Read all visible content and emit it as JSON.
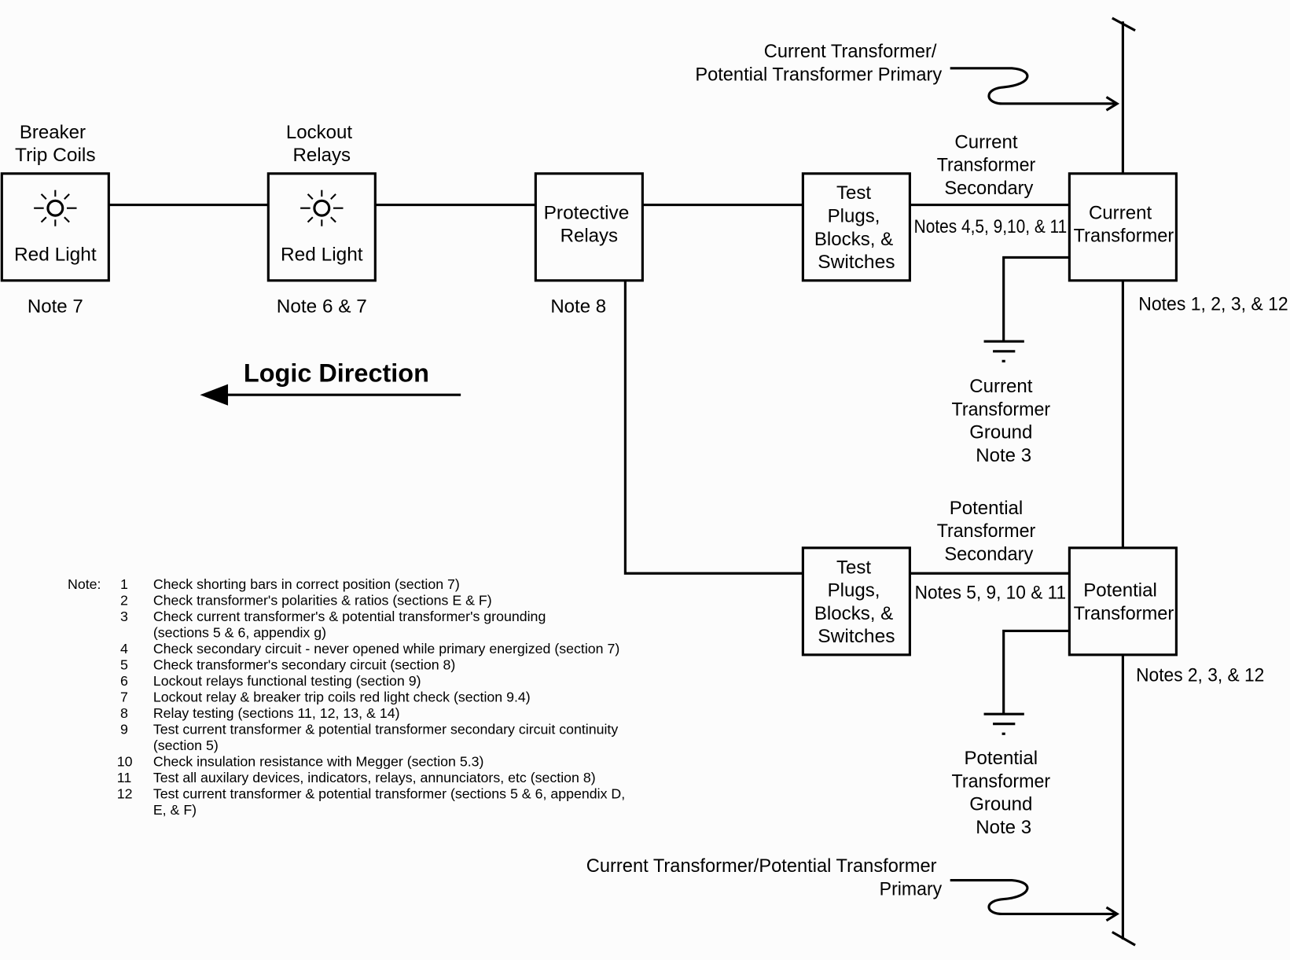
{
  "colors": {
    "line": "#000000",
    "background": "#fcfcfc"
  },
  "primary_top": [
    "Current Transformer/",
    "Potential Transformer Primary"
  ],
  "primary_bottom": [
    "Current Transformer/Potential Transformer",
    "Primary"
  ],
  "breaker": {
    "title": [
      "Breaker",
      "Trip Coils"
    ],
    "label": "Red Light",
    "note": "Note 7",
    "icon": "light-icon"
  },
  "lockout": {
    "title": [
      "Lockout",
      "Relays"
    ],
    "label": "Red Light",
    "note": "Note 6 & 7",
    "icon": "light-icon"
  },
  "protective": {
    "label": [
      "Protective",
      "Relays"
    ],
    "note": "Note 8"
  },
  "test_ct": {
    "label": [
      "Test",
      "Plugs,",
      "Blocks, &",
      "Switches"
    ]
  },
  "test_pt": {
    "label": [
      "Test",
      "Plugs,",
      "Blocks, &",
      "Switches"
    ]
  },
  "ct_secondary": {
    "title": [
      "Current",
      "Transformer",
      "Secondary"
    ],
    "notes": "Notes 4,5, 9,10, & 11"
  },
  "pt_secondary": {
    "title": [
      "Potential",
      "Transformer",
      "Secondary"
    ],
    "notes": "Notes 5, 9, 10 & 11"
  },
  "ct": {
    "label": [
      "Current",
      "Transformer"
    ],
    "notes": "Notes 1, 2, 3, & 12"
  },
  "pt": {
    "label": [
      "Potential",
      "Transformer"
    ],
    "notes": "Notes 2, 3, & 12"
  },
  "ct_ground": [
    "Current",
    "Transformer",
    "Ground",
    "Note 3"
  ],
  "pt_ground": [
    "Potential",
    "Transformer",
    "Ground",
    "Note 3"
  ],
  "logic_direction": "Logic Direction",
  "notes": {
    "heading": "Note:",
    "items": [
      {
        "num": "1",
        "text": "Check shorting bars in correct position (section 7)"
      },
      {
        "num": "2",
        "text": "Check transformer's polarities & ratios  (sections E & F)"
      },
      {
        "num": "3",
        "text": "Check current transformer's & potential transformer's grounding",
        "cont": "(sections 5 & 6, appendix g)"
      },
      {
        "num": "4",
        "text": "Check secondary circuit - never opened while primary energized (section 7)"
      },
      {
        "num": "5",
        "text": "Check transformer's secondary circuit (section 8)"
      },
      {
        "num": "6",
        "text": "Lockout relays functional testing (section 9)"
      },
      {
        "num": "7",
        "text": "Lockout relay & breaker trip coils red light check (section 9.4)"
      },
      {
        "num": "8",
        "text": "Relay testing (sections 11, 12, 13, & 14)"
      },
      {
        "num": "9",
        "text": "Test current transformer & potential transformer secondary circuit continuity",
        "cont": "(section 5)"
      },
      {
        "num": "10",
        "text": "Check insulation resistance with Megger (section 5.3)"
      },
      {
        "num": "11",
        "text": "Test all auxilary devices, indicators, relays, annunciators, etc (section 8)"
      },
      {
        "num": "12",
        "text": "Test current transformer & potential transformer (sections 5 & 6, appendix D,",
        "cont": "E, & F)"
      }
    ]
  }
}
